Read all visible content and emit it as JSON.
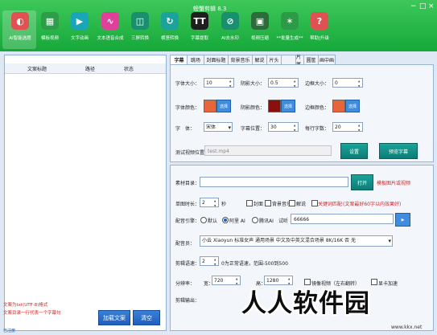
{
  "window": {
    "title": "螃蟹剪辑 8.3",
    "controls": [
      "−",
      "□",
      "×"
    ]
  },
  "toolbar": {
    "items": [
      {
        "label": "AI智能选题",
        "icon": "brain-icon",
        "glyph": "◐",
        "color": "#e05252"
      },
      {
        "label": "模板视频",
        "icon": "template-icon",
        "glyph": "▦",
        "color": "#2e9d4a"
      },
      {
        "label": "文字动画",
        "icon": "play-icon",
        "glyph": "▶",
        "color": "#18a6b8"
      },
      {
        "label": "文本语音合成",
        "icon": "waveform-icon",
        "glyph": "∿",
        "color": "#e0409a"
      },
      {
        "label": "三屏转换",
        "icon": "screens-icon",
        "glyph": "◫",
        "color": "#1a8f6e"
      },
      {
        "label": "横竖转换",
        "icon": "rotate-icon",
        "glyph": "↻",
        "color": "#1aa39a"
      },
      {
        "label": "字幕提取",
        "icon": "text-icon",
        "glyph": "TT",
        "color": "#1e1e1e"
      },
      {
        "label": "AI去水印",
        "icon": "erase-icon",
        "glyph": "⊘",
        "color": "#1a8f6e"
      },
      {
        "label": "视频压缩",
        "icon": "compress-icon",
        "glyph": "▣",
        "color": "#2e6b3a"
      },
      {
        "label": "**批量生成**",
        "icon": "wand-icon",
        "glyph": "✶",
        "color": "#2d9a47"
      },
      {
        "label": "帮助|升级",
        "icon": "help-icon",
        "glyph": "?",
        "color": "#e05252"
      }
    ]
  },
  "left": {
    "columns": [
      "文案标题",
      "路径",
      "状态"
    ],
    "notes": [
      "文案为txt(UTF-8)格式",
      "文案目录一行代表一个字幕句"
    ],
    "load_button": "加载文案",
    "clear_button": "清空",
    "status_link": "已注册"
  },
  "tabs": [
    "字幕",
    "跳场",
    "封面标题",
    "背景音乐",
    "解说",
    "片头",
    "",
    "片尾",
    "画面",
    "圆筐",
    "画中画"
  ],
  "subtitle": {
    "font_size_label": "字体大小：",
    "font_size": "10",
    "shadow_size_label": "阴影大小：",
    "shadow_size": "0.5",
    "border_size_label": "边框大小：",
    "border_size": "0",
    "font_color_label": "字体颜色：",
    "font_color": "#e8643a",
    "shadow_color_label": "阴影颜色：",
    "shadow_color": "#8a1010",
    "border_color_label": "边框颜色：",
    "border_color": "#e8643a",
    "select_label": "选择",
    "font_label": "字　体：",
    "font": "宋体",
    "position_label": "字幕位置：",
    "position": "30",
    "chars_label": "每行字数：",
    "chars": "20",
    "test_video_label": "测试视频位置：",
    "test_video": "test.mp4",
    "set_button": "设置",
    "preview_button": "预览字幕"
  },
  "material": {
    "dir_label": "素材目录：",
    "dir_value": "",
    "open_button": "打开",
    "dir_hint": "模板图片或视频",
    "single_duration_label": "单图时长：",
    "single_duration": "2",
    "sec": "秒",
    "cover_label": "封面",
    "bgm_label": "背景音乐",
    "narration_label": "解说",
    "keyword_label": "关键词匹配",
    "keyword_hint": "(文案最好60字以内效果好)",
    "engine_label": "配音引擎：",
    "engine_options": [
      "默认",
      "阿里 AI",
      "腾讯AI"
    ],
    "trial_label": "试听",
    "trial_value": "66666",
    "voice_label": "配音员：",
    "voice_value": "小云 Xiaoyun 标准女声 通用场景 中文及中英文混合场景 8K/16K 否 无",
    "speed_label": "剪辑语速：",
    "speed": "2",
    "speed_hint": "0为正常语速，范围-500到500",
    "res_label": "分辨率：",
    "width_label": "宽：",
    "width": "720",
    "height_label": "高：",
    "height": "1280",
    "mirror_label": "镜像视频（左右翻转）",
    "gpu_label": "显卡加速",
    "output_label": "剪辑输出："
  },
  "watermark": {
    "text": "人人软件园",
    "url": "www.kkx.net"
  }
}
